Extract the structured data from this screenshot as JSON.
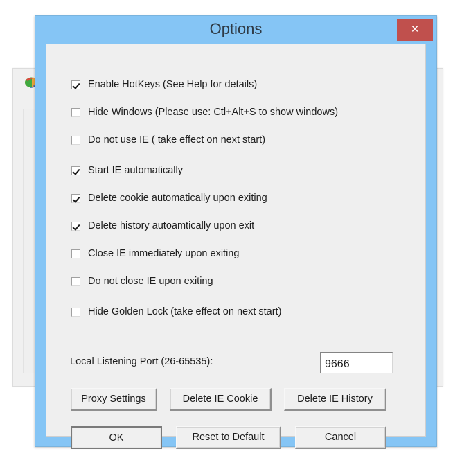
{
  "background_window": {
    "app_icon": "globe-icon"
  },
  "dialog": {
    "title": "Options",
    "close_label": "×",
    "checkboxes": [
      {
        "label": "Enable HotKeys (See Help for details)",
        "checked": true
      },
      {
        "label": "Hide Windows (Please use: Ctl+Alt+S to show windows)",
        "checked": false
      },
      {
        "label": "Do not use IE ( take effect on next start)",
        "checked": false
      },
      {
        "label": "Start IE automatically",
        "checked": true
      },
      {
        "label": "Delete cookie automatically upon exiting",
        "checked": true
      },
      {
        "label": "Delete history autoamtically upon exit",
        "checked": true
      },
      {
        "label": "Close IE immediately upon exiting",
        "checked": false
      },
      {
        "label": "Do not close IE upon exiting",
        "checked": false
      },
      {
        "label": "Hide Golden Lock (take effect on next start)",
        "checked": false
      }
    ],
    "port": {
      "label": "Local Listening Port (26-65535):",
      "value": "9666"
    },
    "action_buttons": [
      {
        "label": "Proxy Settings"
      },
      {
        "label": "Delete IE Cookie"
      },
      {
        "label": "Delete IE History"
      }
    ],
    "footer_buttons": [
      {
        "label": "OK",
        "default": true
      },
      {
        "label": "Reset to Default",
        "default": false
      },
      {
        "label": "Cancel",
        "default": false
      }
    ]
  },
  "colors": {
    "titlebar": "#85c5f5",
    "close_button": "#c0504d",
    "dialog_body": "#efefef",
    "text": "#1d1d1d"
  }
}
